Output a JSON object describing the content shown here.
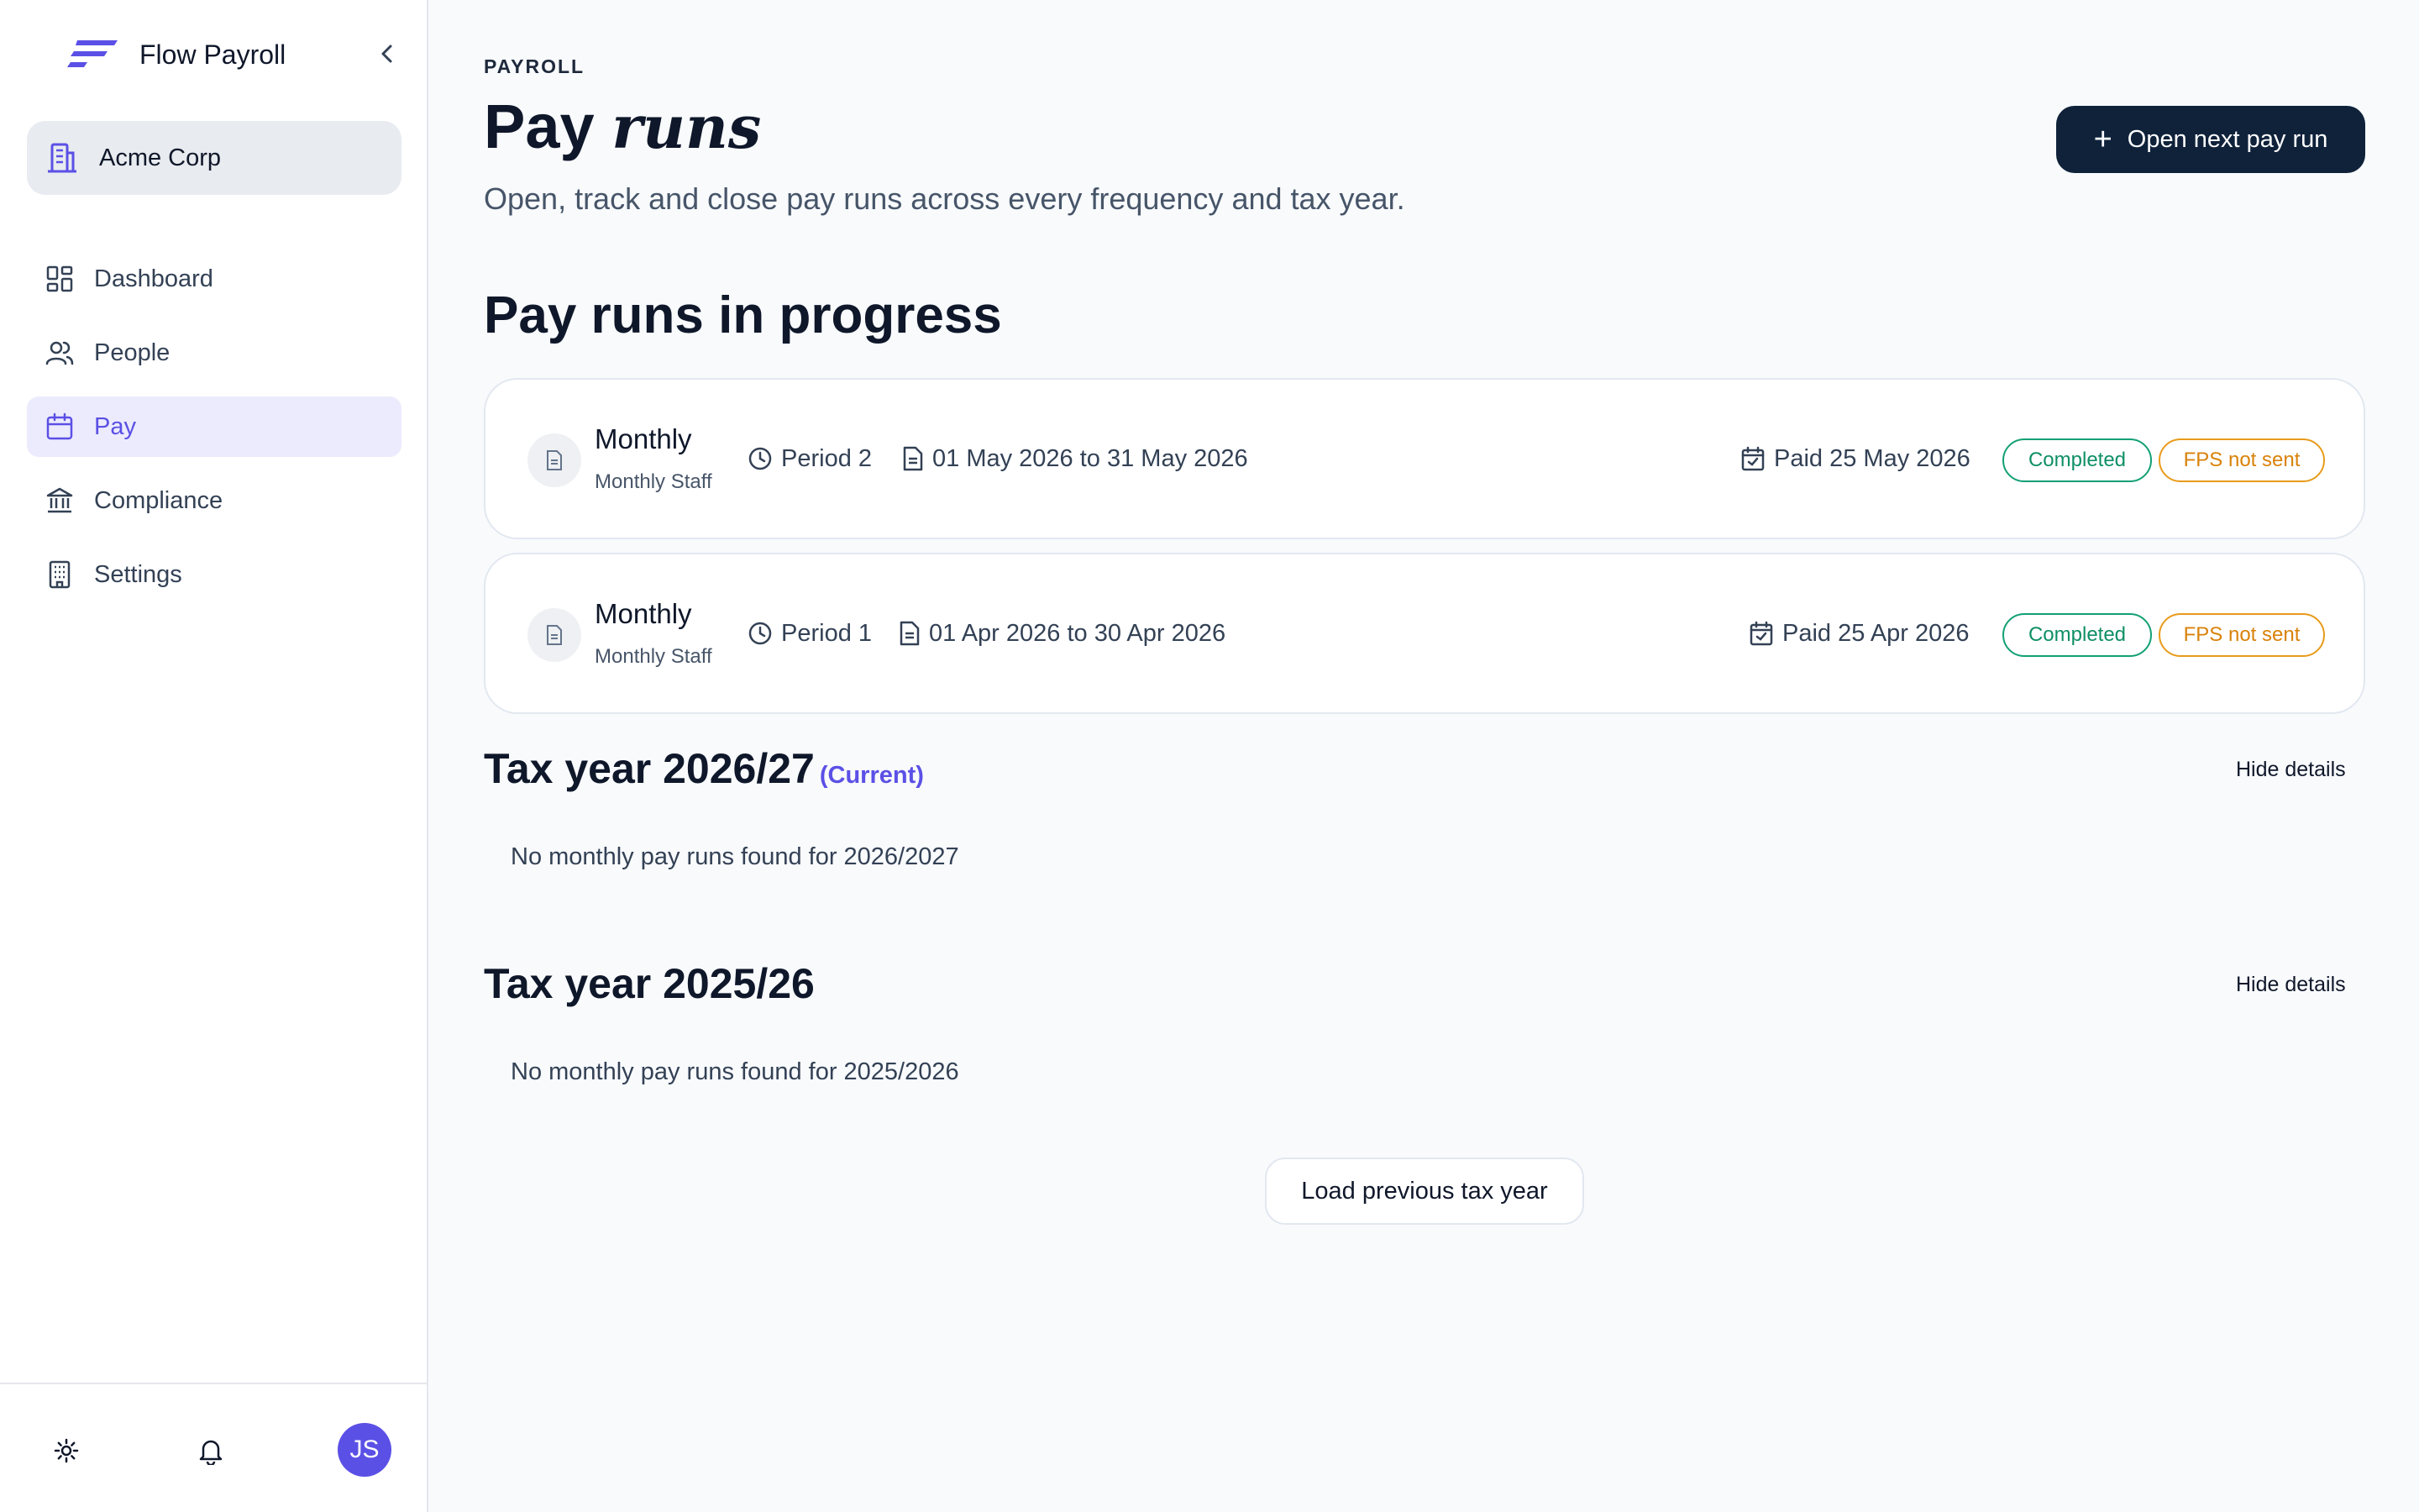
{
  "app": {
    "name": "Flow Payroll"
  },
  "org": {
    "name": "Acme Corp"
  },
  "sidebar": {
    "items": [
      {
        "label": "Dashboard",
        "icon": "dashboard-icon",
        "active": false
      },
      {
        "label": "People",
        "icon": "people-icon",
        "active": false
      },
      {
        "label": "Pay",
        "icon": "calendar-icon",
        "active": true
      },
      {
        "label": "Compliance",
        "icon": "bank-icon",
        "active": false
      },
      {
        "label": "Settings",
        "icon": "building-icon",
        "active": false
      }
    ]
  },
  "user": {
    "initials": "JS"
  },
  "header": {
    "eyebrow": "PAYROLL",
    "title_main": "Pay",
    "title_italic": "runs",
    "subtitle": "Open, track and close pay runs across every frequency and tax year.",
    "primary_button": "Open next pay run"
  },
  "in_progress": {
    "title": "Pay runs in progress",
    "runs": [
      {
        "frequency": "Monthly",
        "group": "Monthly Staff",
        "period": "Period 2",
        "date_range": "01 May 2026 to 31 May 2026",
        "paid": "Paid 25 May 2026",
        "status": "Completed",
        "fps": "FPS not sent"
      },
      {
        "frequency": "Monthly",
        "group": "Monthly Staff",
        "period": "Period 1",
        "date_range": "01 Apr 2026 to 30 Apr 2026",
        "paid": "Paid 25 Apr 2026",
        "status": "Completed",
        "fps": "FPS not sent"
      }
    ]
  },
  "tax_years": [
    {
      "title": "Tax year 2026/27",
      "tag": "(Current)",
      "toggle": "Hide details",
      "empty": "No monthly pay runs found for 2026/2027"
    },
    {
      "title": "Tax year 2025/26",
      "tag": "",
      "toggle": "Hide details",
      "empty": "No monthly pay runs found for 2025/2026"
    }
  ],
  "load_previous": "Load previous tax year",
  "colors": {
    "accent": "#5b50e6",
    "primary_button": "#0f223a",
    "completed": "#12a074",
    "fps_warning": "#e89b1b"
  }
}
